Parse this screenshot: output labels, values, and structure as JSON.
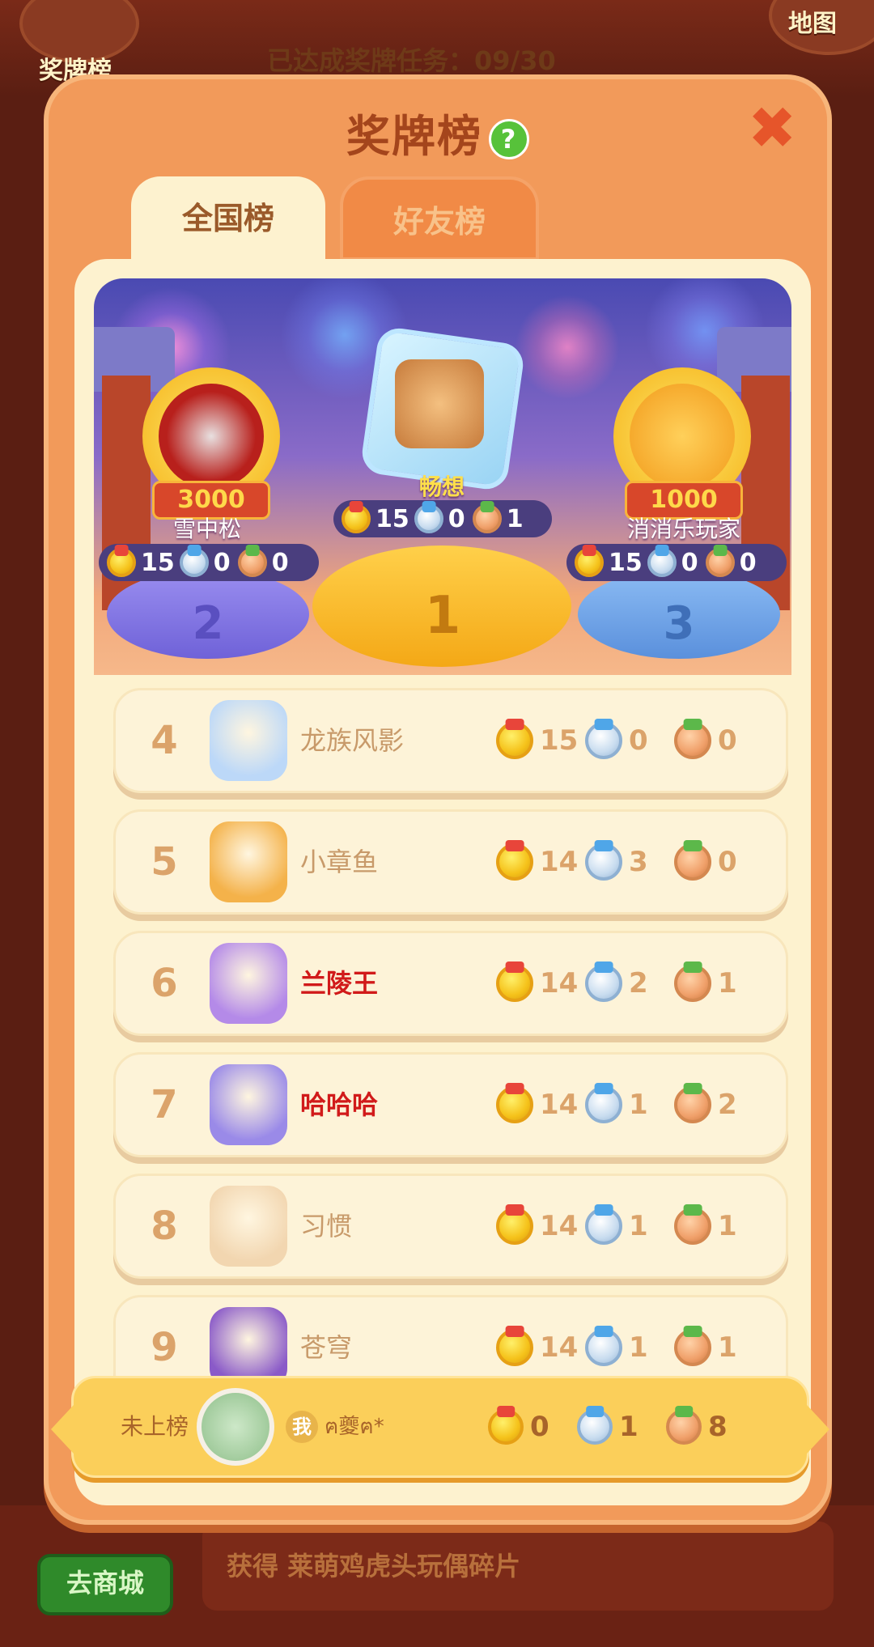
{
  "background": {
    "left_button_label": "奖牌榜",
    "right_button_label": "地图",
    "progress_text": "已达成奖牌任务：09/30",
    "shop_button": "去商城",
    "reward_text": "获得 莱萌鸡虎头玩偶碎片"
  },
  "modal": {
    "title": "奖牌榜",
    "tabs": [
      "全国榜",
      "好友榜"
    ],
    "active_tab": "全国榜"
  },
  "podium": [
    {
      "rank": "2",
      "name": "雪中松",
      "badge": "3000",
      "gold": "15",
      "silver": "0",
      "bronze": "0"
    },
    {
      "rank": "1",
      "name": "畅想",
      "badge": "",
      "gold": "15",
      "silver": "0",
      "bronze": "1"
    },
    {
      "rank": "3",
      "name": "消消乐玩家",
      "badge": "1000",
      "gold": "15",
      "silver": "0",
      "bronze": "0"
    }
  ],
  "rows": [
    {
      "rank": "4",
      "name": "龙族风影",
      "gold": "15",
      "silver": "0",
      "bronze": "0"
    },
    {
      "rank": "5",
      "name": "小章鱼",
      "gold": "14",
      "silver": "3",
      "bronze": "0"
    },
    {
      "rank": "6",
      "name": "兰陵王",
      "gold": "14",
      "silver": "2",
      "bronze": "1"
    },
    {
      "rank": "7",
      "name": "哈哈哈",
      "gold": "14",
      "silver": "1",
      "bronze": "2"
    },
    {
      "rank": "8",
      "name": "习惯",
      "gold": "14",
      "silver": "1",
      "bronze": "1"
    },
    {
      "rank": "9",
      "name": "苍穹",
      "gold": "14",
      "silver": "1",
      "bronze": "1"
    }
  ],
  "my_row": {
    "label": "未上榜",
    "me_badge": "我",
    "name": "ฅ夔ฅ*",
    "gold": "0",
    "silver": "1",
    "bronze": "8"
  },
  "colors": {
    "modal_bg": "#f29a5a",
    "panel_bg": "#fdf2cf",
    "title": "#a4451c",
    "rank_text": "#dba36a",
    "vip_name": "#d11a1a"
  }
}
